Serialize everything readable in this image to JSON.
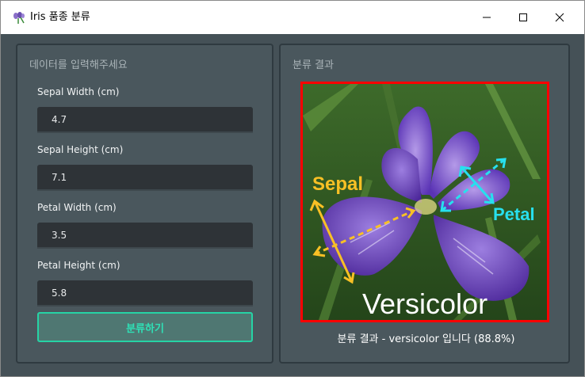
{
  "window": {
    "title": "Iris 품종 분류",
    "icon": "iris-flower-icon"
  },
  "input_panel": {
    "title": "데이터를 입력해주세요",
    "fields": [
      {
        "label": "Sepal Width (cm)",
        "value": "4.7"
      },
      {
        "label": "Sepal Height (cm)",
        "value": "7.1"
      },
      {
        "label": "Petal Width (cm)",
        "value": "3.5"
      },
      {
        "label": "Petal Height (cm)",
        "value": "5.8"
      }
    ],
    "submit_label": "분류하기"
  },
  "result_panel": {
    "title": "분류 결과",
    "image_labels": {
      "sepal": "Sepal",
      "petal": "Petal",
      "species": "Versicolor"
    },
    "result_text": "분류 결과 - versicolor 입니다 (88.8%)"
  },
  "colors": {
    "accent": "#26d3a5",
    "background": "#455157",
    "frame_border": "#ff0000",
    "sepal_label": "#f8c025",
    "petal_label": "#27e0ee"
  }
}
